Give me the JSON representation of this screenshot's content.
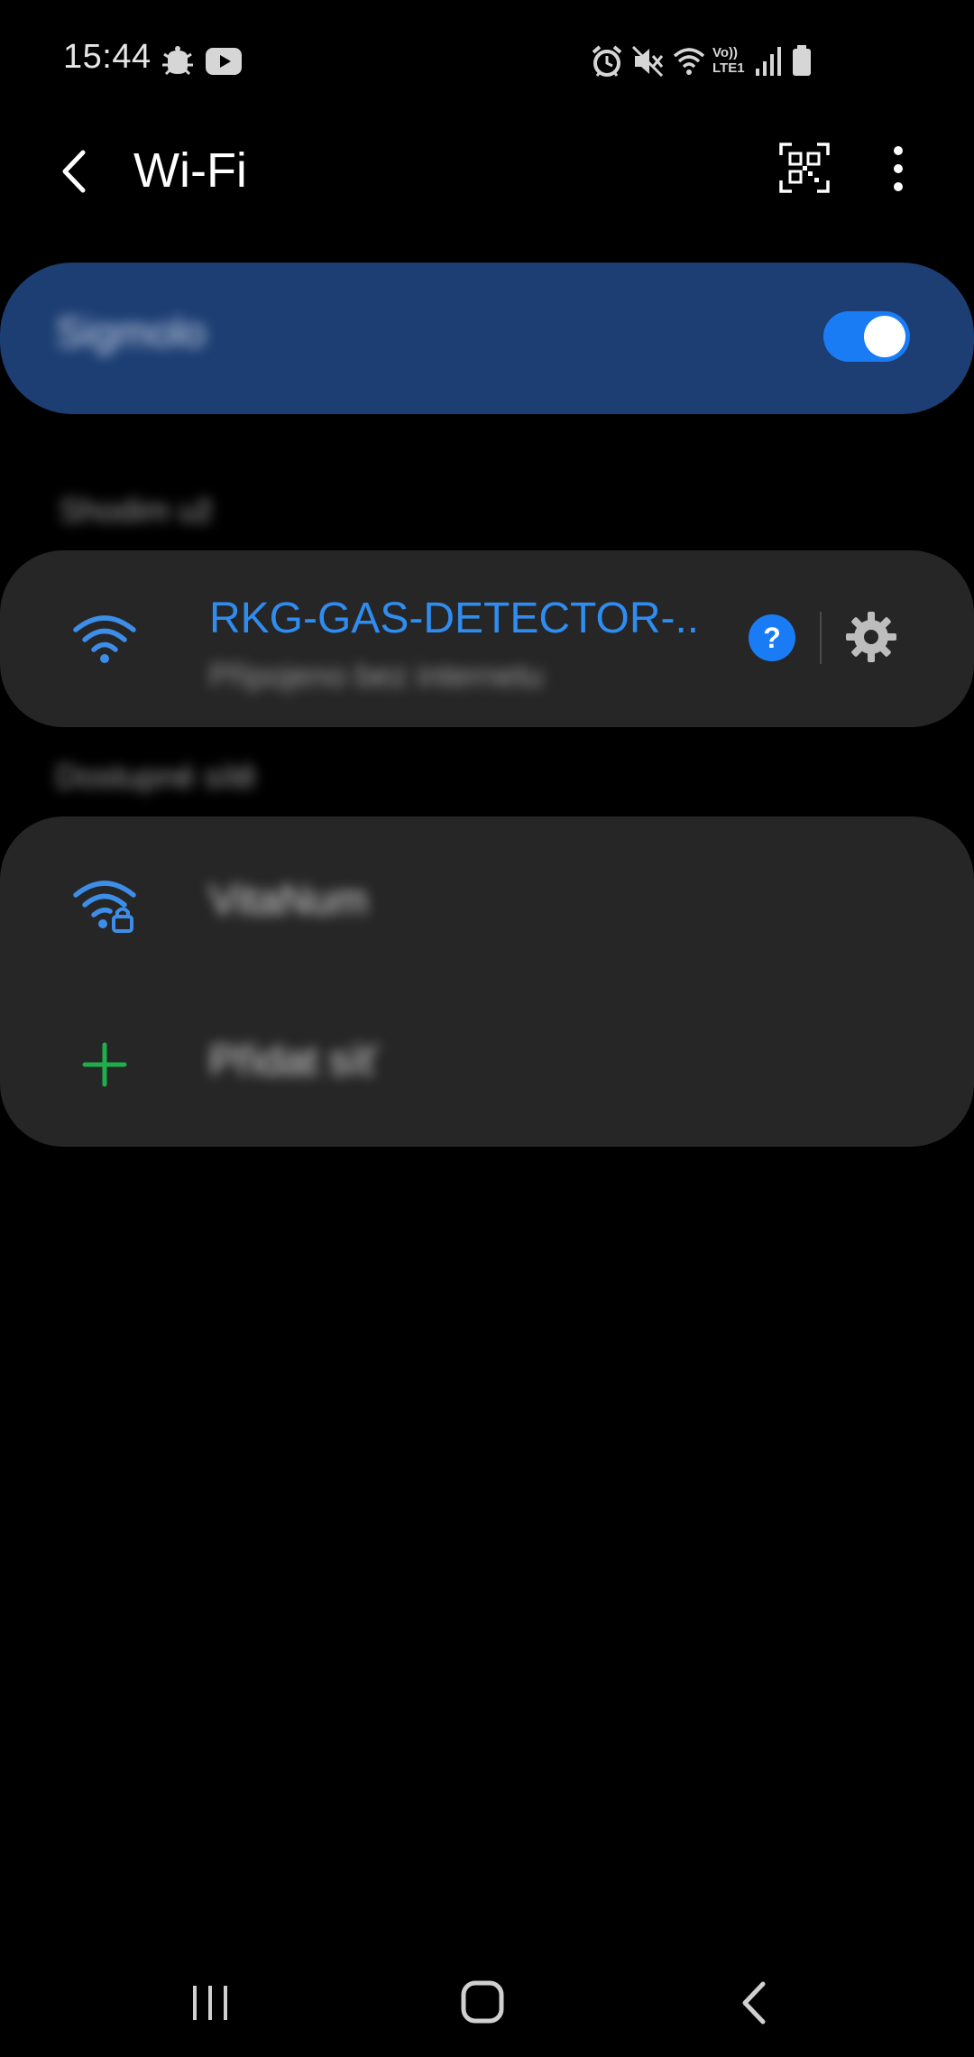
{
  "status_bar": {
    "time": "15:44",
    "left_icons": [
      "bug-icon",
      "youtube-icon"
    ],
    "right_icons": [
      "alarm-icon",
      "mute-icon",
      "wifi-icon",
      "volte-icon",
      "signal-icon",
      "battery-icon"
    ],
    "volte_label_top": "Vo))",
    "volte_label_bottom": "LTE1"
  },
  "app_bar": {
    "title": "Wi-Fi",
    "back_icon": "back-arrow-icon",
    "qr_icon": "qr-code-icon",
    "more_icon": "more-vertical-icon"
  },
  "master_switch": {
    "label": "Sigmolo",
    "enabled": true,
    "accent_color": "#1a7cf5",
    "card_color": "#1c3e73"
  },
  "current_section": {
    "header": "Shodim už"
  },
  "current_network": {
    "name": "RKG-GAS-DETECTOR-..",
    "status": "Připojeno bez internetu",
    "name_color": "#2f8cf0",
    "icon": "wifi-icon",
    "help_icon": "help-icon",
    "settings_icon": "gear-icon"
  },
  "available_section": {
    "header": "Dostupné sítě"
  },
  "available_networks": [
    {
      "name": "VitaNum",
      "icon": "wifi-lock-icon"
    },
    {
      "name": "Přidat síť",
      "icon": "plus-icon"
    }
  ],
  "nav_bar": {
    "recents_icon": "recents-icon",
    "home_icon": "home-icon",
    "back_icon": "back-icon"
  }
}
